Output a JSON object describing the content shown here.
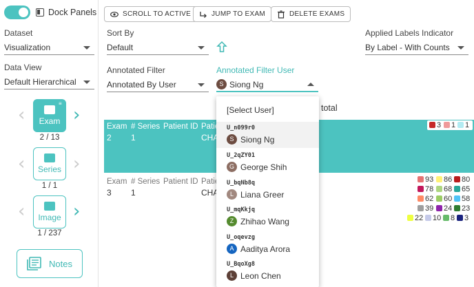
{
  "left_panel": {
    "dock_label": "Dock Panels",
    "dataset_label": "Dataset",
    "dataset_value": "Visualization",
    "dataview_label": "Data View",
    "dataview_value": "Default Hierarchical",
    "exam_label": "Exam",
    "exam_count": "2 / 13",
    "series_label": "Series",
    "series_count": "1 / 1",
    "image_label": "Image",
    "image_count": "1 / 237",
    "notes_label": "Notes"
  },
  "toolbar": {
    "scroll_label": "SCROLL TO ACTIVE",
    "jump_label": "JUMP TO EXAM",
    "delete_label": "DELETE EXAMS"
  },
  "filters": {
    "sort_label": "Sort By",
    "sort_value": "Default",
    "applied_label": "Applied Labels Indicator",
    "applied_value": "By Label - With Counts",
    "annotated_label": "Annotated Filter",
    "annotated_value": "Annotated By User",
    "user_label": "Annotated Filter User",
    "user_value": "Siong Ng",
    "user_initial": "S"
  },
  "list": {
    "total_fragment": "total",
    "rows": [
      {
        "h_exam": "Exam",
        "h_series": "# Series",
        "h_patient": "Patient ID",
        "h_patient2": "Patie",
        "exam": "2",
        "series": "1",
        "patient2": "CHA",
        "labels": [
          {
            "color": "#c62828",
            "count": "3"
          },
          {
            "color": "#ef9a9a",
            "count": "1"
          },
          {
            "color": "#b2ebf2",
            "count": "1"
          }
        ]
      },
      {
        "h_exam": "Exam",
        "h_series": "# Series",
        "h_patient": "Patient ID",
        "h_patient2": "Patie",
        "exam": "3",
        "series": "1",
        "patient2": "CHA",
        "labels": [
          {
            "color": "#e57373",
            "count": "93"
          },
          {
            "color": "#fff176",
            "count": "86"
          },
          {
            "color": "#b71c1c",
            "count": "80"
          },
          {
            "color": "#c2185b",
            "count": "78"
          },
          {
            "color": "#aed581",
            "count": "68"
          },
          {
            "color": "#26a69a",
            "count": "65"
          },
          {
            "color": "#ff8a65",
            "count": "62"
          },
          {
            "color": "#9ccc65",
            "count": "60"
          },
          {
            "color": "#4fc3f7",
            "count": "58"
          },
          {
            "color": "#9e9e9e",
            "count": "39"
          },
          {
            "color": "#8e24aa",
            "count": "24"
          },
          {
            "color": "#2e7d32",
            "count": "23"
          },
          {
            "color": "#eeff41",
            "count": "22"
          },
          {
            "color": "#c5cae9",
            "count": "10"
          },
          {
            "color": "#66bb6a",
            "count": "8"
          },
          {
            "color": "#1a237e",
            "count": "3"
          }
        ]
      }
    ]
  },
  "user_dropdown": {
    "placeholder": "[Select User]",
    "users": [
      {
        "id": "U_n099r0",
        "name": "Siong Ng",
        "initial": "S",
        "avatar_color": "#6d4c41"
      },
      {
        "id": "U_2qZY01",
        "name": "George Shih",
        "initial": "G",
        "avatar_color": "#8d6e63"
      },
      {
        "id": "U_bqNb8q",
        "name": "Liana Greer",
        "initial": "L",
        "avatar_color": "#a1887f"
      },
      {
        "id": "U_mqKkjq",
        "name": "Zhihao Wang",
        "initial": "Z",
        "avatar_color": "#558b2f"
      },
      {
        "id": "U_oqevzg",
        "name": "Aaditya Arora",
        "initial": "A",
        "avatar_color": "#1565c0"
      },
      {
        "id": "U_BqoXg8",
        "name": "Leon Chen",
        "initial": "L",
        "avatar_color": "#5d4037"
      }
    ]
  }
}
